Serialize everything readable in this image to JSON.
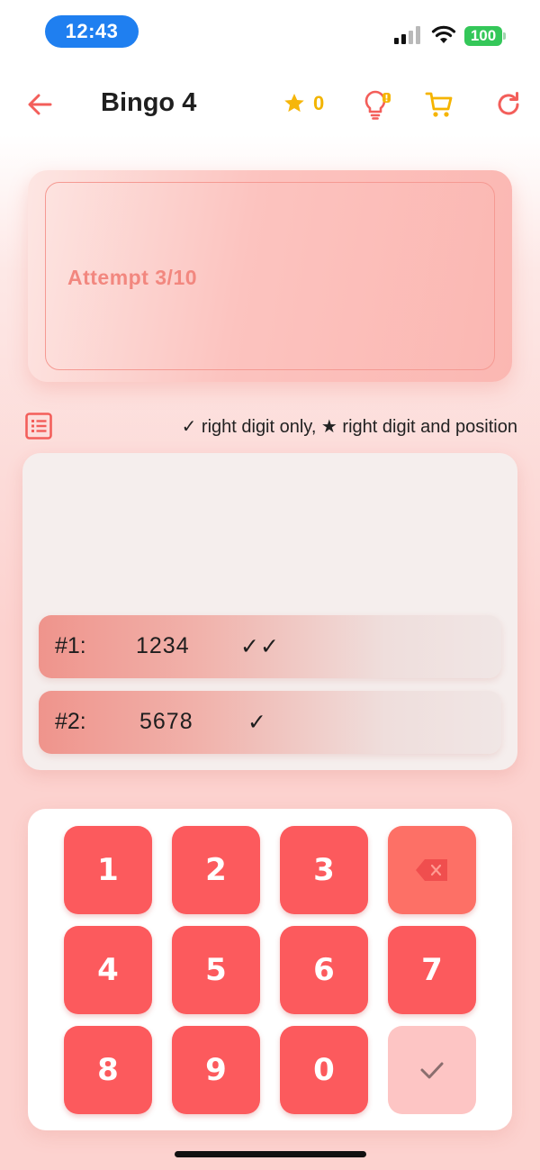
{
  "status_bar": {
    "time": "12:43",
    "battery": "100"
  },
  "app_bar": {
    "title": "Bingo 4",
    "stars": "0"
  },
  "attempt": {
    "text": "Attempt 3/10"
  },
  "legend": {
    "text": "✓ right digit only, ★ right digit and position"
  },
  "history": [
    {
      "index": "#1:",
      "number": "1234",
      "result": "✓✓"
    },
    {
      "index": "#2:",
      "number": "5678",
      "result": "✓"
    }
  ],
  "keypad": {
    "row1": [
      "1",
      "2",
      "3"
    ],
    "row2": [
      "4",
      "5",
      "6",
      "7"
    ],
    "row3": [
      "8",
      "9",
      "0"
    ]
  },
  "colors": {
    "accent": "#fc5a5d",
    "star": "#f2b400",
    "status_pill": "#1f7ff0",
    "battery": "#34c759"
  },
  "icons": [
    "back-arrow-icon",
    "star-icon",
    "lightbulb-icon",
    "cart-icon",
    "restart-icon",
    "list-icon",
    "backspace-icon",
    "check-icon"
  ]
}
